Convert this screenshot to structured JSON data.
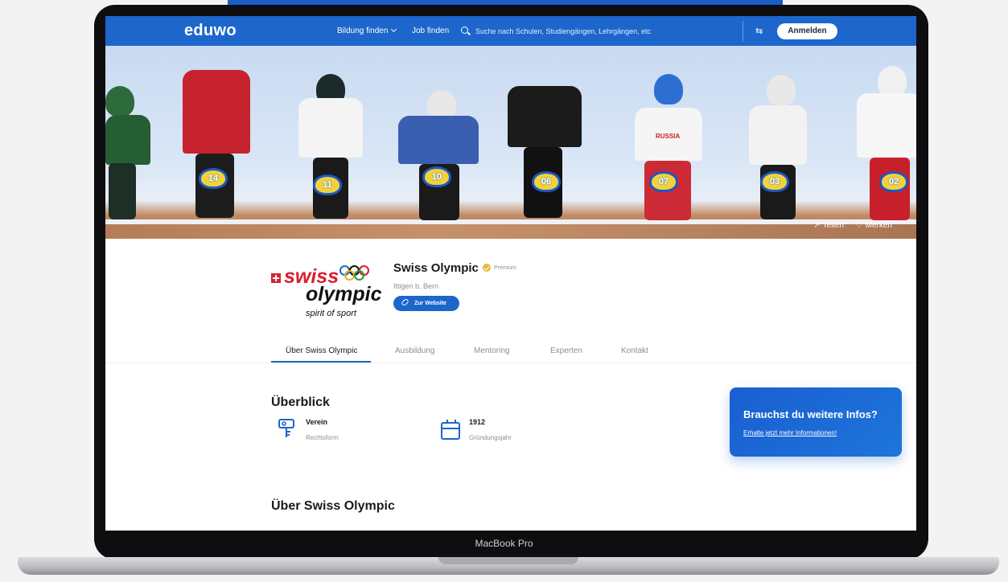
{
  "device": {
    "label": "MacBook Pro"
  },
  "nav": {
    "logo": "eduwo",
    "links": [
      "Bildung finden",
      "Job finden"
    ],
    "search_placeholder": "Suche nach Schulen, Studiengängen, Lehrgängen, etc",
    "login_label": "Anmelden"
  },
  "hero": {
    "plates": [
      "14",
      "11",
      "10",
      "06",
      "07",
      "03",
      "02"
    ],
    "jersey_text": "RUSSIA",
    "actions": {
      "share": "Teilen",
      "save": "Merken"
    }
  },
  "profile": {
    "logo": {
      "swiss": "swiss",
      "olympic": "olympic",
      "tagline": "spirit of sport"
    },
    "name": "Swiss Olympic",
    "badge": "Premium",
    "location": "Ittigen b. Bern",
    "website_label": "Zur Website"
  },
  "tabs": [
    "Über Swiss Olympic",
    "Ausbildung",
    "Mentoring",
    "Experten",
    "Kontakt"
  ],
  "overview": {
    "title": "Überblick",
    "facts": [
      {
        "value": "Verein",
        "label": "Rechtsform",
        "icon": "legal-form-icon"
      },
      {
        "value": "1912",
        "label": "Gründungsjahr",
        "icon": "calendar-icon"
      }
    ]
  },
  "about": {
    "title": "Über Swiss Olympic"
  },
  "info_card": {
    "title": "Brauchst du weitere Infos?",
    "link": "Erhalte jetzt mehr Informationen!"
  },
  "colors": {
    "brand": "#1d66cc",
    "swiss_red": "#d9202d",
    "premium": "#e4b73b"
  }
}
